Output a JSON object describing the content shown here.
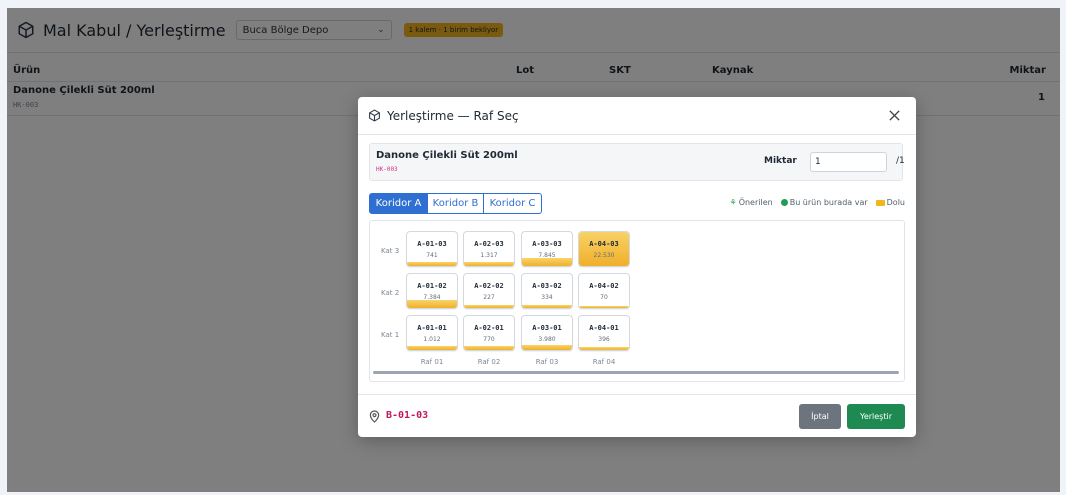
{
  "app": {
    "title": "Mal Kabul / Yerleştirme",
    "depot": "Buca Bölge Depo",
    "pending_badge": "1 kalem · 1 birim bekliyor"
  },
  "table": {
    "headers": {
      "product": "Ürün",
      "lot": "Lot",
      "skt": "SKT",
      "source": "Kaynak",
      "qty": "Miktar"
    },
    "rows": [
      {
        "name": "Danone Çilekli Süt 200ml",
        "code": "HK-003",
        "qty": "1"
      }
    ]
  },
  "modal": {
    "title": "Yerleştirme — Raf Seç",
    "product_name": "Danone Çilekli Süt 200ml",
    "product_code": "HK-003",
    "qty_label": "Miktar",
    "qty_value": "1",
    "qty_max": "/1",
    "tabs": [
      "Koridor A",
      "Koridor B",
      "Koridor C"
    ],
    "active_tab": 0,
    "legend": {
      "recommended": "Önerilen",
      "here": "Bu ürün burada var",
      "full": "Dolu"
    },
    "row_labels": [
      "Kat 3",
      "Kat 2",
      "Kat 1"
    ],
    "col_labels": [
      "Raf 01",
      "Raf 02",
      "Raf 03",
      "Raf 04"
    ],
    "cells": [
      [
        {
          "code": "A-01-03",
          "stock": "741",
          "fill": 0.1
        },
        {
          "code": "A-02-03",
          "stock": "1.317",
          "fill": 0.1
        },
        {
          "code": "A-03-03",
          "stock": "7.845",
          "fill": 0.22
        },
        {
          "code": "A-04-03",
          "stock": "22.530",
          "fill": 1.0
        }
      ],
      [
        {
          "code": "A-01-02",
          "stock": "7.384",
          "fill": 0.22
        },
        {
          "code": "A-02-02",
          "stock": "227",
          "fill": 0.08
        },
        {
          "code": "A-03-02",
          "stock": "334",
          "fill": 0.08
        },
        {
          "code": "A-04-02",
          "stock": "70",
          "fill": 0.06
        }
      ],
      [
        {
          "code": "A-01-01",
          "stock": "1.012",
          "fill": 0.12
        },
        {
          "code": "A-02-01",
          "stock": "770",
          "fill": 0.1
        },
        {
          "code": "A-03-01",
          "stock": "3.980",
          "fill": 0.15
        },
        {
          "code": "A-04-01",
          "stock": "396",
          "fill": 0.08
        }
      ]
    ],
    "selected_location": "B-01-03",
    "cancel_label": "İptal",
    "place_label": "Yerleştir"
  },
  "colors": {
    "accent": "#2f6fd1",
    "success": "#1e8a52",
    "warning": "#f2b51c",
    "location": "#c2185b"
  }
}
